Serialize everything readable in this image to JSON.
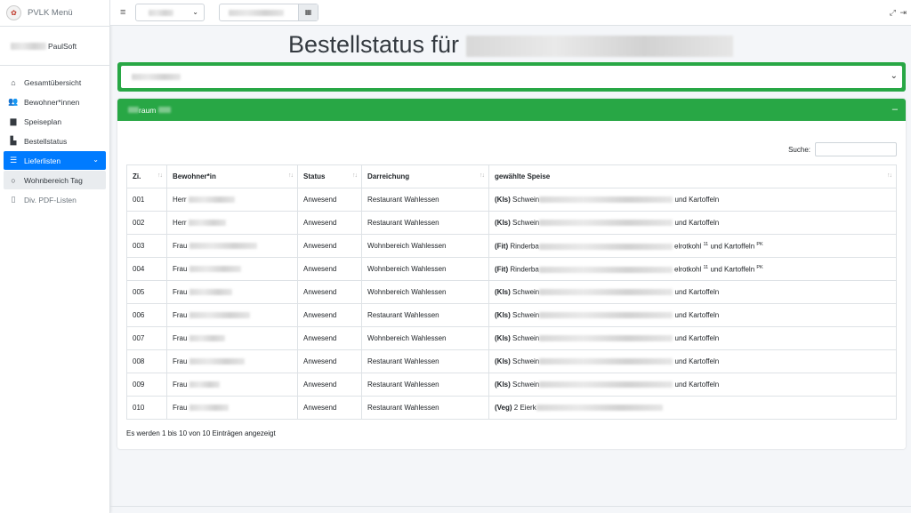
{
  "app": {
    "name": "PVLK Menü",
    "user_suffix": "PaulSoft"
  },
  "sidebar": {
    "items": [
      {
        "label": "Gesamtübersicht",
        "icon": "home-icon"
      },
      {
        "label": "Bewohner*innen",
        "icon": "users-icon"
      },
      {
        "label": "Speiseplan",
        "icon": "book-icon"
      },
      {
        "label": "Bestellstatus",
        "icon": "chart-icon"
      },
      {
        "label": "Lieferlisten",
        "icon": "list-icon"
      },
      {
        "label": "Wohnbereich Tag",
        "icon": "circle-icon"
      },
      {
        "label": "Div. PDF-Listen",
        "icon": "file-icon"
      }
    ]
  },
  "header": {
    "title": "Bestellstatus für"
  },
  "card": {
    "header_label": "raum",
    "search_label": "Suche:",
    "columns": [
      "Zi.",
      "Bewohner*in",
      "Status",
      "Darreichung",
      "gewählte Speise"
    ],
    "rows": [
      {
        "zi": "001",
        "anrede": "Herr",
        "status": "Anwesend",
        "darreichung": "Restaurant Wahlessen",
        "typ": "(Kls)",
        "speise_a": "Schwein",
        "speise_b": "und Kartoffeln",
        "sup1": "",
        "sup2": ""
      },
      {
        "zi": "002",
        "anrede": "Herr",
        "status": "Anwesend",
        "darreichung": "Restaurant Wahlessen",
        "typ": "(Kls)",
        "speise_a": "Schwein",
        "speise_b": "und Kartoffeln",
        "sup1": "",
        "sup2": ""
      },
      {
        "zi": "003",
        "anrede": "Frau",
        "status": "Anwesend",
        "darreichung": "Wohnbereich Wahlessen",
        "typ": "(Fit)",
        "speise_a": "Rinderba",
        "speise_b": "elrotkohl",
        "sup1": "11",
        "speise_c": "und Kartoffeln",
        "sup2": "PK"
      },
      {
        "zi": "004",
        "anrede": "Frau",
        "status": "Anwesend",
        "darreichung": "Wohnbereich Wahlessen",
        "typ": "(Fit)",
        "speise_a": "Rinderba",
        "speise_b": "elrotkohl",
        "sup1": "11",
        "speise_c": "und Kartoffeln",
        "sup2": "PK"
      },
      {
        "zi": "005",
        "anrede": "Frau",
        "status": "Anwesend",
        "darreichung": "Wohnbereich Wahlessen",
        "typ": "(Kls)",
        "speise_a": "Schwein",
        "speise_b": "und Kartoffeln",
        "sup1": "",
        "sup2": ""
      },
      {
        "zi": "006",
        "anrede": "Frau",
        "status": "Anwesend",
        "darreichung": "Restaurant Wahlessen",
        "typ": "(Kls)",
        "speise_a": "Schwein",
        "speise_b": "und Kartoffeln",
        "sup1": "",
        "sup2": ""
      },
      {
        "zi": "007",
        "anrede": "Frau",
        "status": "Anwesend",
        "darreichung": "Wohnbereich Wahlessen",
        "typ": "(Kls)",
        "speise_a": "Schwein",
        "speise_b": "und Kartoffeln",
        "sup1": "",
        "sup2": ""
      },
      {
        "zi": "008",
        "anrede": "Frau",
        "status": "Anwesend",
        "darreichung": "Restaurant Wahlessen",
        "typ": "(Kls)",
        "speise_a": "Schwein",
        "speise_b": "und Kartoffeln",
        "sup1": "",
        "sup2": ""
      },
      {
        "zi": "009",
        "anrede": "Frau",
        "status": "Anwesend",
        "darreichung": "Restaurant Wahlessen",
        "typ": "(Kls)",
        "speise_a": "Schwein",
        "speise_b": "und Kartoffeln",
        "sup1": "",
        "sup2": ""
      },
      {
        "zi": "010",
        "anrede": "Frau",
        "status": "Anwesend",
        "darreichung": "Restaurant Wahlessen",
        "typ": "(Veg)",
        "speise_a": "2 Eierk",
        "speise_b": "",
        "sup1": "",
        "sup2": ""
      }
    ],
    "info": "Es werden 1 bis 10 von 10 Einträgen angezeigt"
  },
  "colors": {
    "accent": "#007bff",
    "success": "#28a745"
  }
}
